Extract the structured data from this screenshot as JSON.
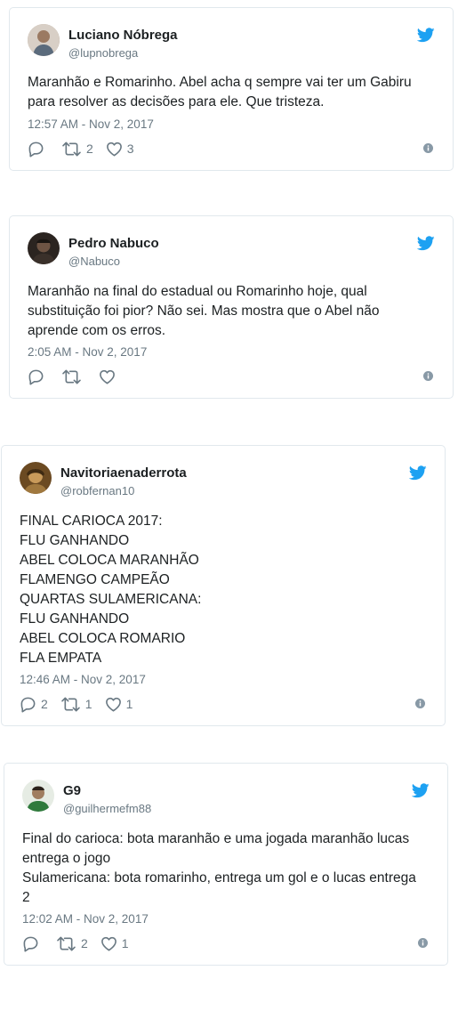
{
  "colors": {
    "twitter_blue": "#1da1f2",
    "icon_gray": "#697882",
    "border": "#e1e8ed"
  },
  "tweets": [
    {
      "name": "Luciano Nóbrega",
      "handle": "@lupnobrega",
      "text_lines": [
        "Maranhão e Romarinho. Abel acha q sempre vai ter um Gabiru",
        "para resolver as decisões para ele. Que tristeza."
      ],
      "time": "12:57 AM - Nov 2, 2017",
      "replies": "",
      "retweets": "2",
      "likes": "3"
    },
    {
      "name": "Pedro Nabuco",
      "handle": "@Nabuco",
      "text_lines": [
        "Maranhão na final do estadual ou Romarinho hoje, qual",
        "substituição foi pior? Não sei. Mas mostra que o Abel não",
        "aprende com os erros."
      ],
      "time": "2:05 AM - Nov 2, 2017",
      "replies": "",
      "retweets": "",
      "likes": ""
    },
    {
      "name": "Navitoriaenaderrota",
      "handle": "@robfernan10",
      "text_lines": [
        "FINAL CARIOCA 2017:",
        "FLU GANHANDO",
        "ABEL COLOCA MARANHÃO",
        "FLAMENGO CAMPEÃO",
        "QUARTAS SULAMERICANA:",
        "FLU GANHANDO",
        "ABEL COLOCA ROMARIO",
        "FLA EMPATA"
      ],
      "time": "12:46 AM - Nov 2, 2017",
      "replies": "2",
      "retweets": "1",
      "likes": "1"
    },
    {
      "name": "G9",
      "handle": "@guilhermefm88",
      "text_lines": [
        "Final do carioca: bota maranhão e uma jogada maranhão lucas",
        "entrega o jogo",
        "Sulamericana: bota romarinho, entrega um gol e o lucas entrega",
        "2"
      ],
      "time": "12:02 AM - Nov 2, 2017",
      "replies": "",
      "retweets": "2",
      "likes": "1"
    }
  ]
}
